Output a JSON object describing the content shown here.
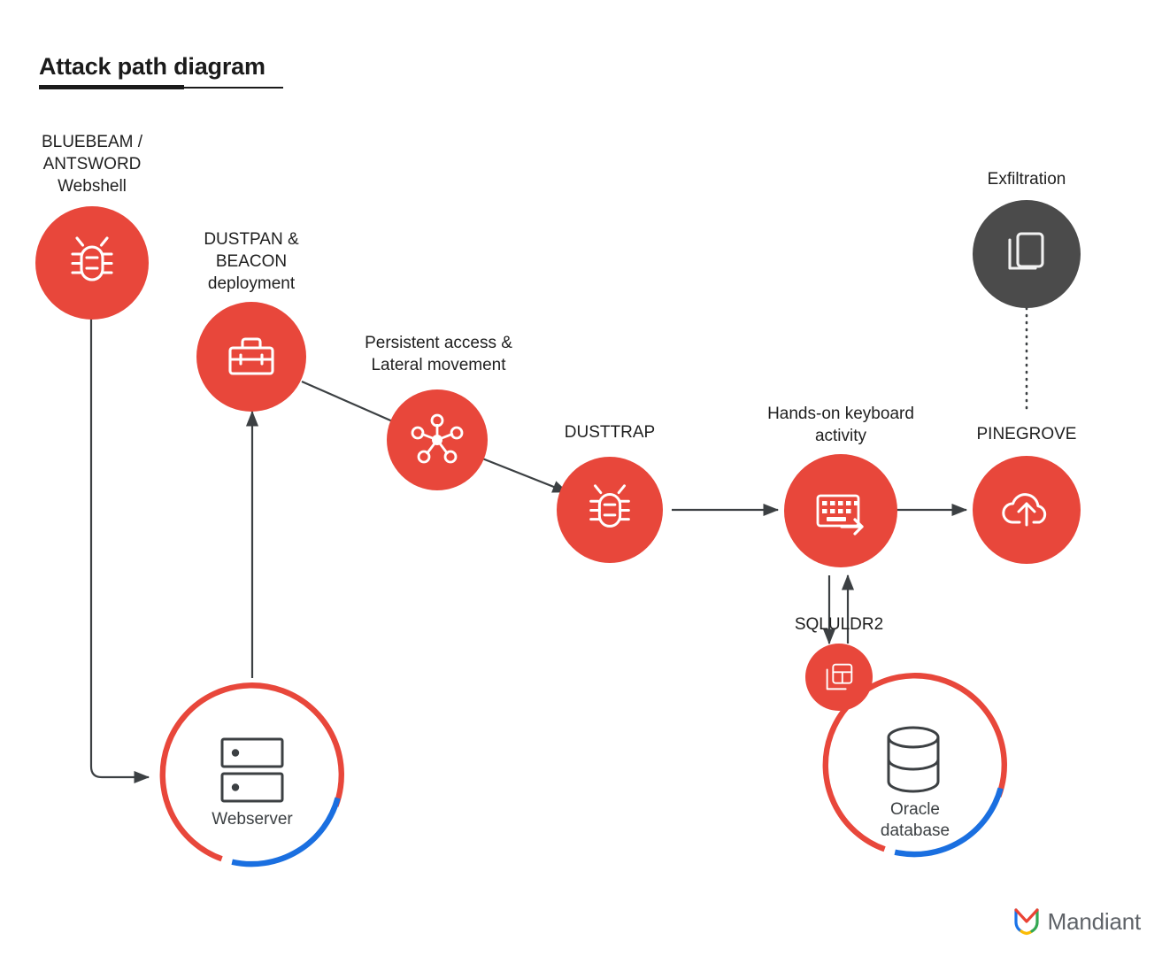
{
  "page": {
    "title": "Attack path diagram",
    "background_color": "#ffffff"
  },
  "colors": {
    "accent_red": "#e8473b",
    "accent_blue": "#1a6fe0",
    "dark_node": "#4b4b4b",
    "connector": "#3c4043",
    "text": "#1f1f1f",
    "icon_gray": "#3c4043"
  },
  "nodes": {
    "webshell": {
      "label": "BLUEBEAM /\nANTSWORD\nWebshell",
      "icon": "bug-icon",
      "color": "#e8473b",
      "shape": "filled-circle"
    },
    "deployment": {
      "label": "DUSTPAN &\nBEACON\ndeployment",
      "icon": "toolbox-icon",
      "color": "#e8473b",
      "shape": "filled-circle"
    },
    "lateral": {
      "label": "Persistent access &\nLateral movement",
      "icon": "network-nodes-icon",
      "color": "#e8473b",
      "shape": "filled-circle"
    },
    "dusttrap": {
      "label": "DUSTTRAP",
      "icon": "bug-icon",
      "color": "#e8473b",
      "shape": "filled-circle"
    },
    "keyboard": {
      "label": "Hands-on keyboard\nactivity",
      "icon": "keyboard-arrow-icon",
      "color": "#e8473b",
      "shape": "filled-circle"
    },
    "pinegrove": {
      "label": "PINEGROVE",
      "icon": "cloud-upload-icon",
      "color": "#e8473b",
      "shape": "filled-circle"
    },
    "exfiltration": {
      "label": "Exfiltration",
      "icon": "copy-documents-icon",
      "color": "#4b4b4b",
      "shape": "filled-circle"
    },
    "sqluldr2": {
      "label": "SQLULDR2",
      "icon": "table-layout-icon",
      "color": "#e8473b",
      "shape": "filled-circle"
    },
    "webserver": {
      "label": "Webserver",
      "icon": "server-rack-icon",
      "shape": "ring",
      "ring_colors": [
        "#e8473b",
        "#1a6fe0"
      ]
    },
    "oracle": {
      "label": "Oracle\ndatabase",
      "icon": "database-cylinder-icon",
      "shape": "ring",
      "ring_colors": [
        "#e8473b",
        "#1a6fe0"
      ]
    }
  },
  "connectors": [
    {
      "name": "webshell-to-webserver",
      "from": "webshell",
      "to": "webserver",
      "style": "solid",
      "arrow": "end"
    },
    {
      "name": "webserver-to-deployment",
      "from": "webserver",
      "to": "deployment",
      "style": "solid",
      "arrow": "end"
    },
    {
      "name": "deployment-to-lateral",
      "from": "deployment",
      "to": "lateral",
      "style": "solid",
      "arrow": "none"
    },
    {
      "name": "lateral-to-dusttrap",
      "from": "lateral",
      "to": "dusttrap",
      "style": "solid",
      "arrow": "end"
    },
    {
      "name": "dusttrap-to-keyboard",
      "from": "dusttrap",
      "to": "keyboard",
      "style": "solid",
      "arrow": "end"
    },
    {
      "name": "keyboard-to-pinegrove",
      "from": "keyboard",
      "to": "pinegrove",
      "style": "solid",
      "arrow": "end"
    },
    {
      "name": "keyboard-to-sqluldr2",
      "from": "keyboard",
      "to": "sqluldr2",
      "style": "solid",
      "arrow": "end"
    },
    {
      "name": "sqluldr2-to-keyboard",
      "from": "sqluldr2",
      "to": "keyboard",
      "style": "solid",
      "arrow": "end"
    },
    {
      "name": "exfiltration-to-pinegrove",
      "from": "exfiltration",
      "to": "pinegrove",
      "style": "dotted",
      "arrow": "none"
    }
  ],
  "branding": {
    "wordmark": "Mandiant",
    "mark": "mandiant-shield-icon"
  }
}
